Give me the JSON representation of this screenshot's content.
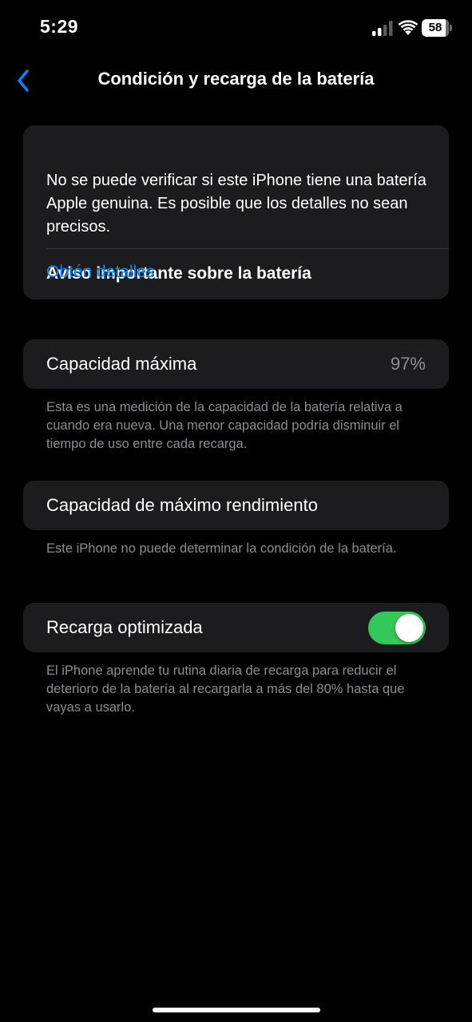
{
  "status_bar": {
    "time": "5:29",
    "battery_level": "58",
    "icons": [
      "signal-icon",
      "wifi-icon",
      "battery-icon"
    ]
  },
  "nav": {
    "back_icon": "chevron-left-icon",
    "title": "Condición y recarga de la batería"
  },
  "notice": {
    "title": "Aviso importante sobre la batería",
    "body": "No se puede verificar si este iPhone tiene una batería Apple genuina. Es posible que los detalles no sean precisos.",
    "link": "Obtén detalles"
  },
  "max_capacity": {
    "label": "Capacidad máxima",
    "value": "97%",
    "footnote": "Esta es una medición de la capacidad de la batería relativa a cuando era nueva. Una menor capacidad podría disminuir el tiempo de uso entre cada recarga."
  },
  "peak_performance": {
    "label": "Capacidad de máximo rendimiento",
    "footnote": "Este iPhone no puede determinar la condición de la batería."
  },
  "optimized_charging": {
    "label": "Recarga optimizada",
    "enabled": true,
    "footnote": "El iPhone aprende tu rutina diaria de recarga para reducir el deterioro de la batería al recargarla a más del 80% hasta que vayas a usarlo."
  },
  "colors": {
    "background": "#000000",
    "card": "#1c1c1e",
    "accent": "#0a84ff",
    "toggle_on": "#34c759",
    "secondary_text": "#8d8d93"
  }
}
